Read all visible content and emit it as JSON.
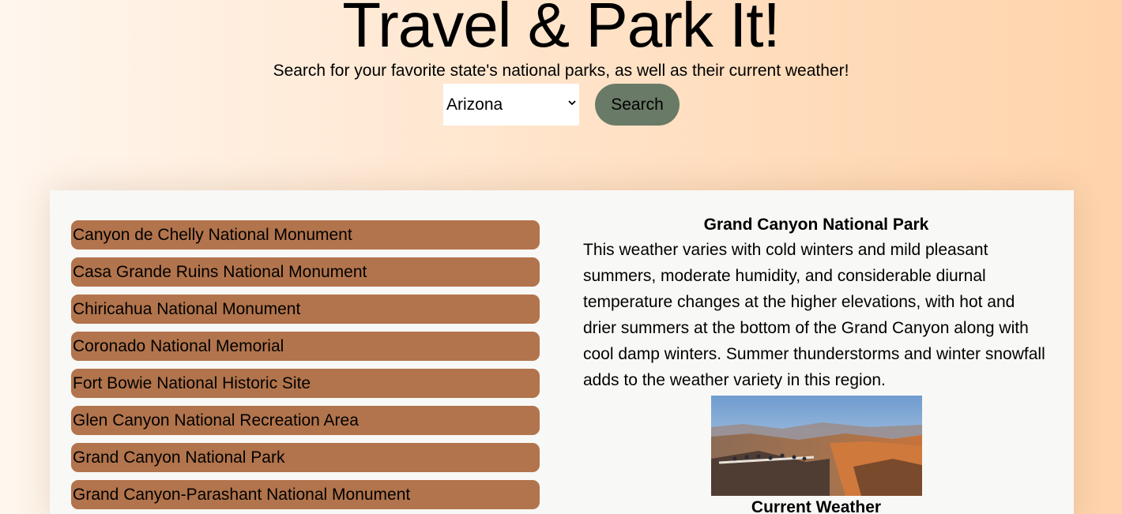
{
  "header": {
    "title": "Travel & Park It!",
    "subtitle": "Search for your favorite state's national parks, as well as their current weather!"
  },
  "search": {
    "selected_state": "Arizona",
    "button_label": "Search",
    "button_color": "#697a66"
  },
  "parks": [
    {
      "name": "Canyon de Chelly National Monument"
    },
    {
      "name": "Casa Grande Ruins National Monument"
    },
    {
      "name": "Chiricahua National Monument"
    },
    {
      "name": "Coronado National Memorial"
    },
    {
      "name": "Fort Bowie National Historic Site"
    },
    {
      "name": "Glen Canyon National Recreation Area"
    },
    {
      "name": "Grand Canyon National Park"
    },
    {
      "name": "Grand Canyon-Parashant National Monument"
    }
  ],
  "detail": {
    "park_name": "Grand Canyon National Park",
    "description": "This weather varies with cold winters and mild pleasant summers, moderate humidity, and considerable diurnal temperature changes at the higher elevations, with hot and drier summers at the bottom of the Grand Canyon along with cool damp winters. Summer thunderstorms and winter snowfall adds to the weather variety in this region.",
    "weather_heading": "Current Weather"
  },
  "colors": {
    "park_item_bg": "#b2744c",
    "card_bg": "#f8f8f6"
  }
}
